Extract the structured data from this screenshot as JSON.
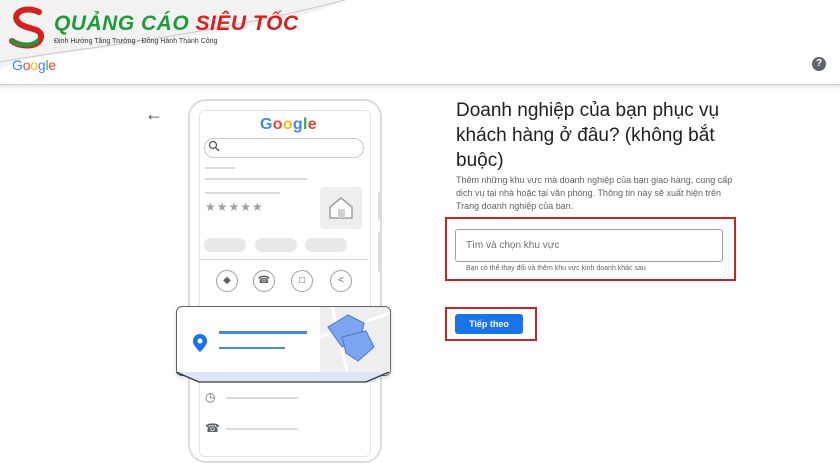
{
  "brand": {
    "title_part1": "QUẢNG CÁO ",
    "title_part2": "SIÊU TỐC",
    "tagline": "Định Hướng Tăng Trưởng - Đồng Hành Thành Công",
    "google_letters": [
      "G",
      "o",
      "o",
      "g",
      "l",
      "e"
    ]
  },
  "phone": {
    "google_letters": [
      "G",
      "o",
      "o",
      "g",
      "l",
      "e"
    ],
    "rating_stars": "★★★★★"
  },
  "form": {
    "title": "Doanh nghiệp của bạn phục vụ khách hàng ở đâu? (không bắt buộc)",
    "description": "Thêm những khu vực mà doanh nghiệp của bạn giao hàng, cung cấp dịch vụ tại nhà hoặc tại văn phòng. Thông tin này sẽ xuất hiện trên Trang doanh nghiệp của bạn.",
    "search_placeholder": "Tìm và chọn khu vực",
    "search_value": "",
    "helper": "Bạn có thể thay đổi và thêm khu vực kinh doanh khác sau",
    "next_label": "Tiếp theo"
  },
  "colors": {
    "google_blue": "#4285F4",
    "google_red": "#EA4335",
    "google_yellow": "#FBBC05",
    "google_green": "#34A853",
    "highlight_red": "#C62828",
    "button_blue": "#1A73E8",
    "brand_green": "#1F9A3A",
    "brand_red": "#D6201F"
  },
  "icons": [
    "back-arrow-icon",
    "help-icon",
    "search-icon",
    "directions-icon",
    "phone-icon",
    "bookmark-icon",
    "share-icon",
    "map-pin-icon",
    "clock-icon",
    "phone-row-icon",
    "storefront-icon",
    "brand-logo-icon"
  ]
}
